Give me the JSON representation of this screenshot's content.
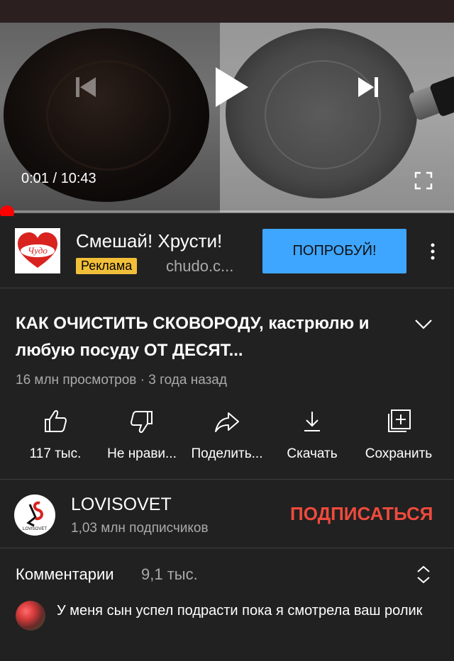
{
  "player": {
    "time": "0:01 / 10:43",
    "progress_fraction": 0.0016,
    "icons": {
      "prev": "skip-previous-icon",
      "play": "play-icon",
      "next": "skip-next-icon",
      "fullscreen": "fullscreen-icon"
    }
  },
  "ad": {
    "brand": "Чудо",
    "title": "Смешай! Хрусти!",
    "badge": "Реклама",
    "domain": "chudo.c...",
    "cta": "ПОПРОБУЙ!"
  },
  "video": {
    "title": "КАК ОЧИСТИТЬ СКОВОРОДУ, кастрюлю и любую посуду ОТ ДЕСЯТ...",
    "meta": "16 млн просмотров · 3 года назад"
  },
  "actions": [
    {
      "label": "117 тыс.",
      "icon": "thumbs-up-icon"
    },
    {
      "label": "Не нрави...",
      "icon": "thumbs-down-icon"
    },
    {
      "label": "Поделить...",
      "icon": "share-icon"
    },
    {
      "label": "Скачать",
      "icon": "download-icon"
    },
    {
      "label": "Сохранить",
      "icon": "save-to-playlist-icon"
    }
  ],
  "channel": {
    "name": "LOVISOVET",
    "subscribers": "1,03 млн подписчиков",
    "subscribe": "ПОДПИСАТЬСЯ",
    "logo_text": "LOVISOVET"
  },
  "comments": {
    "heading": "Комментарии",
    "count": "9,1 тыс.",
    "top_comment": "У меня сын успел подрасти пока я смотрела ваш ролик"
  },
  "colors": {
    "accent_red": "#ff0000",
    "cta_blue": "#3ea6ff",
    "subscribe_red": "#ef4a3c",
    "badge_yellow": "#f2bf39",
    "bg": "#212121"
  }
}
